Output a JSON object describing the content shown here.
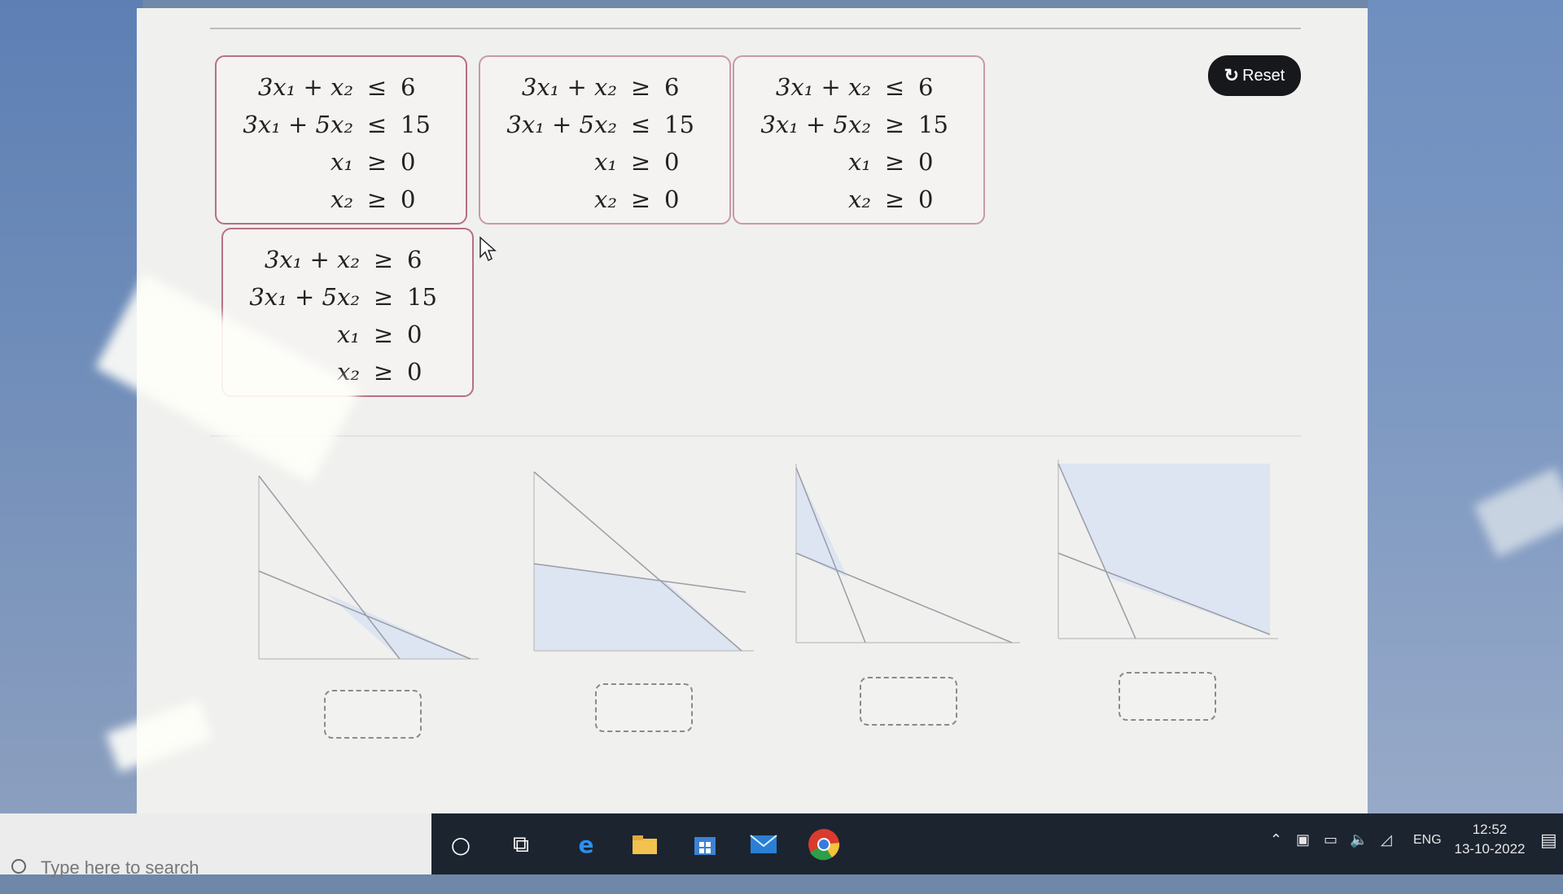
{
  "reset_label": "Reset",
  "cards": [
    {
      "rows": [
        {
          "lhs": "3x₁ + x₂",
          "rel": "≤",
          "rhs": "6"
        },
        {
          "lhs": "3x₁ + 5x₂",
          "rel": "≤",
          "rhs": "15"
        },
        {
          "lhs": "x₁",
          "rel": "≥",
          "rhs": "0"
        },
        {
          "lhs": "x₂",
          "rel": "≥",
          "rhs": "0"
        }
      ]
    },
    {
      "rows": [
        {
          "lhs": "3x₁ + x₂",
          "rel": "≥",
          "rhs": "6"
        },
        {
          "lhs": "3x₁ + 5x₂",
          "rel": "≤",
          "rhs": "15"
        },
        {
          "lhs": "x₁",
          "rel": "≥",
          "rhs": "0"
        },
        {
          "lhs": "x₂",
          "rel": "≥",
          "rhs": "0"
        }
      ]
    },
    {
      "rows": [
        {
          "lhs": "3x₁ + x₂",
          "rel": "≤",
          "rhs": "6"
        },
        {
          "lhs": "3x₁ + 5x₂",
          "rel": "≥",
          "rhs": "15"
        },
        {
          "lhs": "x₁",
          "rel": "≥",
          "rhs": "0"
        },
        {
          "lhs": "x₂",
          "rel": "≥",
          "rhs": "0"
        }
      ]
    },
    {
      "rows": [
        {
          "lhs": "3x₁ + x₂",
          "rel": "≥",
          "rhs": "6"
        },
        {
          "lhs": "3x₁ + 5x₂",
          "rel": "≥",
          "rhs": "15"
        },
        {
          "lhs": "x₁",
          "rel": "≥",
          "rhs": "0"
        },
        {
          "lhs": "x₂",
          "rel": "≥",
          "rhs": "0"
        }
      ]
    }
  ],
  "graphs": [
    {
      "shaded_region": "3x₁ + x₂ ≥ 6 and 3x₁ + 5x₂ ≤ 15"
    },
    {
      "shaded_region": "3x₁ + x₂ ≤ 6 and 3x₁ + 5x₂ ≤ 15"
    },
    {
      "shaded_region": "3x₁ + x₂ ≤ 6 and 3x₁ + 5x₂ ≥ 15"
    },
    {
      "shaded_region": "3x₁ + x₂ ≥ 6 and 3x₁ + 5x₂ ≥ 15"
    }
  ],
  "graph_fill_color": "#dde4f2",
  "line_color": "#9a9da6",
  "taskbar": {
    "search_placeholder": "Type here to search",
    "language": "ENG",
    "time": "12:52",
    "date": "13-10-2022"
  }
}
